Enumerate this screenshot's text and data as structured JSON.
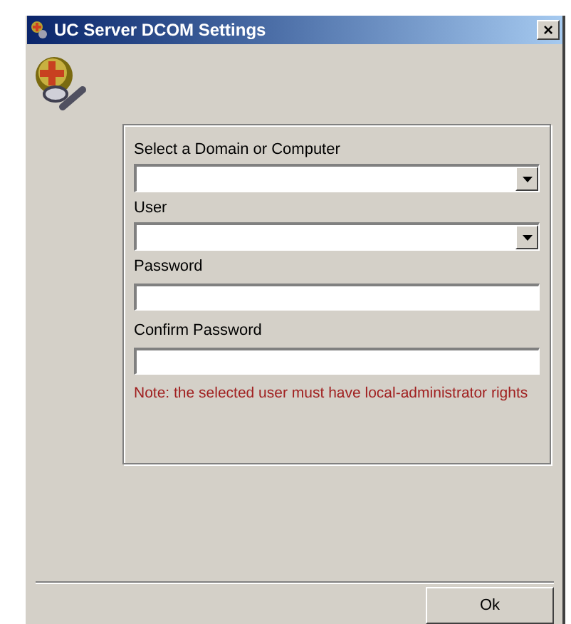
{
  "window": {
    "title": "UC Server DCOM Settings",
    "close": "×"
  },
  "fields": [
    {
      "kind": "combo",
      "label": "Select a Domain or Computer"
    },
    {
      "kind": "combo",
      "label": "User"
    },
    {
      "kind": "text",
      "label": "Password"
    },
    {
      "kind": "text",
      "label": "Confirm Password"
    }
  ],
  "note": "Note: the selected user must have local-administrator rights",
  "buttons": [
    "Ok"
  ]
}
